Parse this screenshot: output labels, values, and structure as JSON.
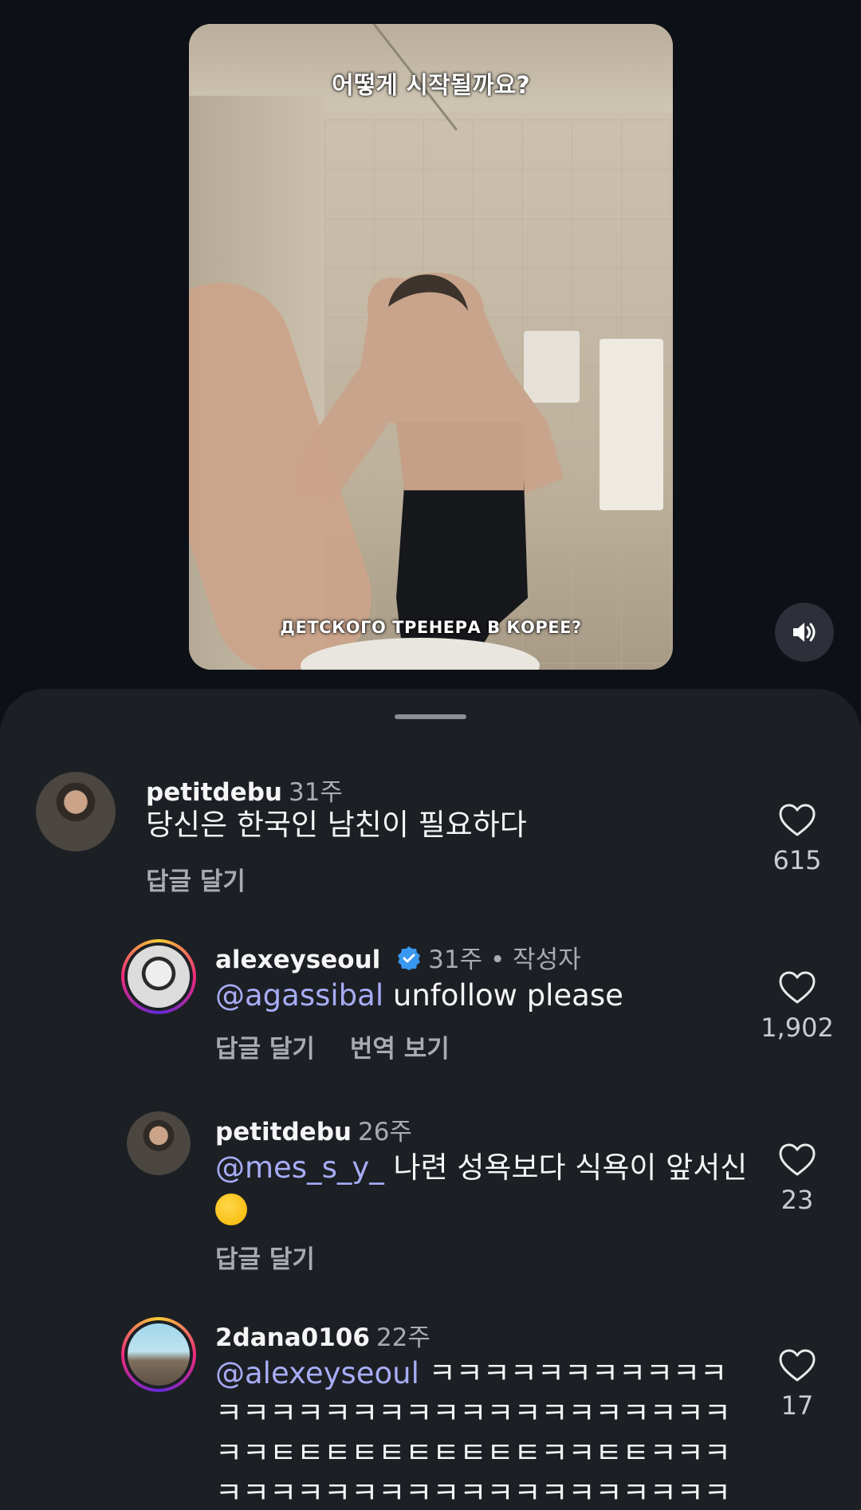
{
  "video": {
    "caption_top": "어떻게 시작될까요?",
    "caption_bottom": "ДЕТСКОГО ТРЕНЕРА В КОРЕЕ?",
    "sound_icon": "speaker-on-icon"
  },
  "comments": [
    {
      "username": "petitdebu",
      "time": "31주",
      "mention": "",
      "text": "당신은 한국인 남친이 필요하다",
      "actions": [
        "답글 달기"
      ],
      "likes": "615"
    },
    {
      "username": "alexeyseoul",
      "time": "31주 • 작성자",
      "mention": "@agassibal",
      "text": " unfollow please",
      "actions": [
        "답글 달기",
        "번역 보기"
      ],
      "likes": "1,902"
    },
    {
      "username": "petitdebu",
      "time": "26주",
      "mention": "@mes_s_y_",
      "text": " 나련 성욕보다 식욕이 앞서신",
      "actions": [
        "답글 달기"
      ],
      "likes": "23"
    },
    {
      "username": "2dana0106",
      "time": "22주",
      "mention": "@alexeyseoul",
      "text": " ㅋㅋㅋㅋㅋㅋㅋㅋㅋㅋㅋㅋㅋㅋㅋㅋㅋㅋㅋㅋㅋㅋㅋㅋㅋㅋㅋㅋㅋㅋㅋㅋㅌㅌㅌㅌㅌㅌㅌㅌㅌㅌㅋㅋㅌㅌㅋㅋㅋㅋㅋㅋㅋㅋㅋㅋㅋㅋㅋㅋㅋㅋㅋㅋㅋㅋㅋㅋㅋㅋㅋㅋㅋㅋㅋㅋㅋ",
      "actions": [],
      "likes": "17"
    }
  ],
  "colors": {
    "background": "#0d1016",
    "sheet": "#1c1f24",
    "mention": "#a7acf5",
    "verified": "#3897f0"
  }
}
